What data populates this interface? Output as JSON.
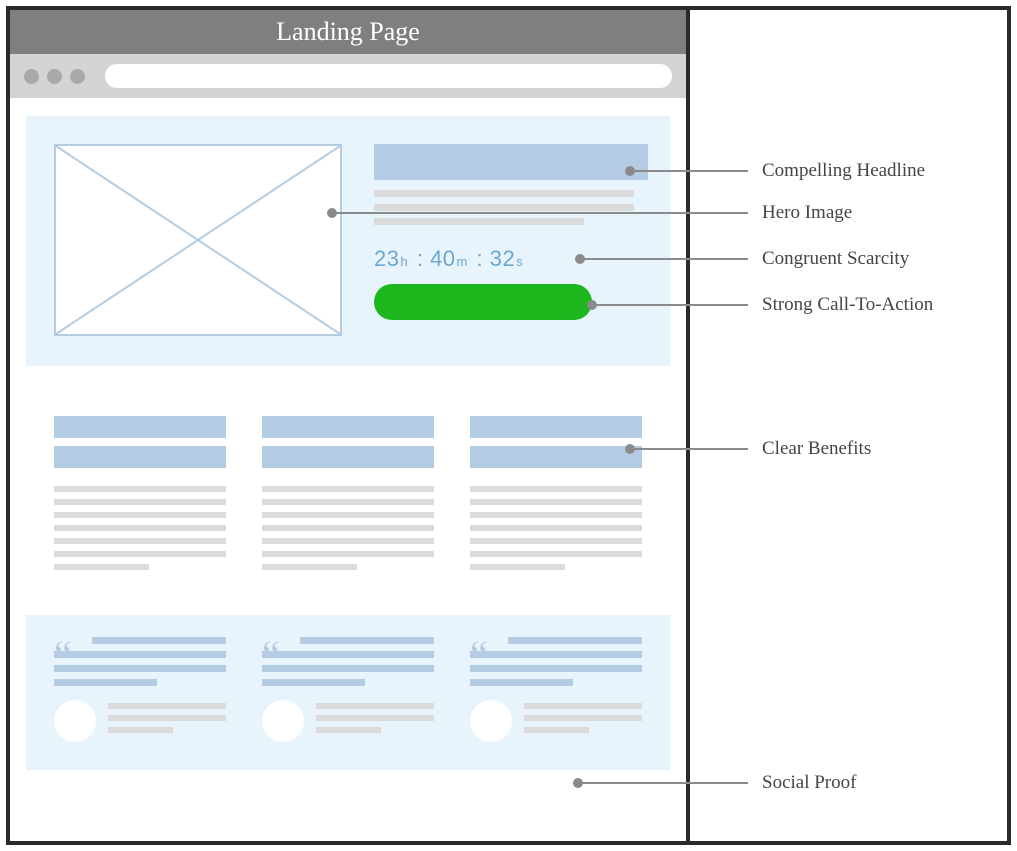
{
  "title": "Landing Page",
  "countdown": {
    "h": "23",
    "m": "40",
    "s": "32",
    "uh": "h",
    "um": "m",
    "us": "s",
    "sep": " : "
  },
  "annotations": {
    "headline": "Compelling Headline",
    "hero": "Hero Image",
    "scarcity": "Congruent Scarcity",
    "cta": "Strong Call-To-Action",
    "benefits": "Clear Benefits",
    "social": "Social Proof"
  }
}
